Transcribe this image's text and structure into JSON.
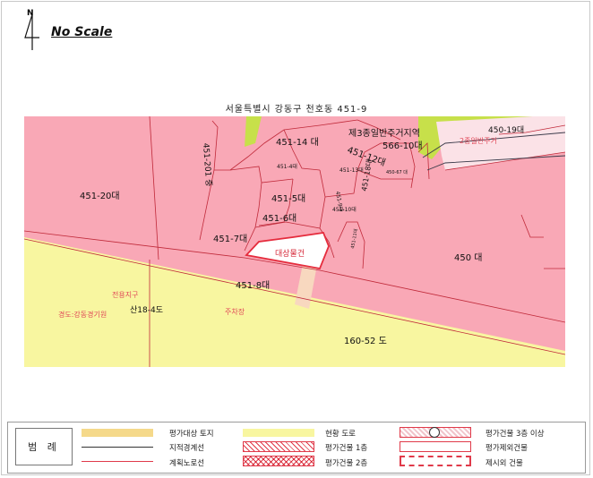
{
  "header": {
    "north_letter": "N",
    "scale_text": "No Scale",
    "map_title": "서울특별시 강동구 천호동 451-9"
  },
  "map": {
    "parcels": [
      {
        "name": "parcel-451-20",
        "label": "451-20대"
      },
      {
        "name": "parcel-451-201",
        "label": "451-201 중"
      },
      {
        "name": "parcel-451-14",
        "label": "451-14 대"
      },
      {
        "name": "parcel-451-5",
        "label": "451-5대"
      },
      {
        "name": "parcel-451-6",
        "label": "451-6대"
      },
      {
        "name": "parcel-451-7",
        "label": "451-7대"
      },
      {
        "name": "parcel-451-8",
        "label": "451-8대"
      },
      {
        "name": "parcel-451-12",
        "label": "451-12대"
      },
      {
        "name": "parcel-451-18",
        "label": "451-18대"
      },
      {
        "name": "parcel-566-10",
        "label": "566-10대"
      },
      {
        "name": "parcel-450",
        "label": "450 대"
      },
      {
        "name": "parcel-450-19",
        "label": "450-19대"
      },
      {
        "name": "parcel-160-52",
        "label": "160-52 도"
      },
      {
        "name": "parcel-san18-4",
        "label": "산18-4도"
      }
    ],
    "small_labels": [
      "451-4대",
      "451-13대",
      "451-10대",
      "451-9대",
      "450-67 대",
      "451-11대"
    ],
    "zone_label": "제3종일반주거지역",
    "subject_label": "대상물건",
    "red_texts": [
      "전용지구",
      "경도:강동경기원",
      "주차장",
      "2종일반주거"
    ]
  },
  "legend": {
    "title": "범 례",
    "items": [
      {
        "name": "legend-evaluation-land",
        "label": "평가대상 토지"
      },
      {
        "name": "legend-current-road",
        "label": "현황 도로"
      },
      {
        "name": "legend-building-3f",
        "label": "평가건물 3층 이상"
      },
      {
        "name": "legend-cadastral-line",
        "label": "지적경계선"
      },
      {
        "name": "legend-building-1f",
        "label": "평가건물 1층"
      },
      {
        "name": "legend-excluded-building",
        "label": "평가제외건물"
      },
      {
        "name": "legend-planned-road-line",
        "label": "계획노로선"
      },
      {
        "name": "legend-building-2f",
        "label": "평가건물 2층"
      },
      {
        "name": "legend-non-subject-building",
        "label": "제시외 건물"
      }
    ]
  },
  "colors": {
    "residential_zone": "#f9a8b6",
    "road": "#f8f6a0",
    "green_zone": "#c7e04a",
    "evaluation_land": "#f5d98a",
    "boundary": "#e52c3d"
  }
}
